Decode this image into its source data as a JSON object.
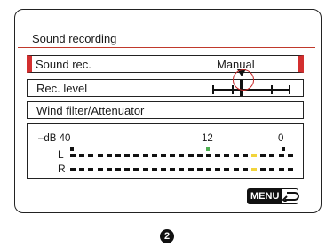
{
  "screen": {
    "title": "Sound recording",
    "menu_items": [
      {
        "label": "Sound rec.",
        "value": "Manual",
        "selected": true
      },
      {
        "label": "Rec. level",
        "value": "",
        "selected": false
      },
      {
        "label": "Wind filter/Attenuator",
        "value": "",
        "selected": false
      }
    ],
    "rec_level": {
      "position": 0.38
    },
    "meter": {
      "scale": {
        "left": "–dB 40",
        "mid": "12",
        "right": "0"
      },
      "channels": [
        {
          "label": "L"
        },
        {
          "label": "R"
        }
      ],
      "marker_colors": {
        "green": "#4caf50",
        "yellow": "#f2d43b"
      }
    },
    "menu_button": {
      "label": "MENU",
      "icon": "return-arrow-icon"
    }
  },
  "callout": {
    "label": "2"
  },
  "colors": {
    "accent": "#d32f2f",
    "text": "#1a1a1a",
    "border": "#222222"
  }
}
